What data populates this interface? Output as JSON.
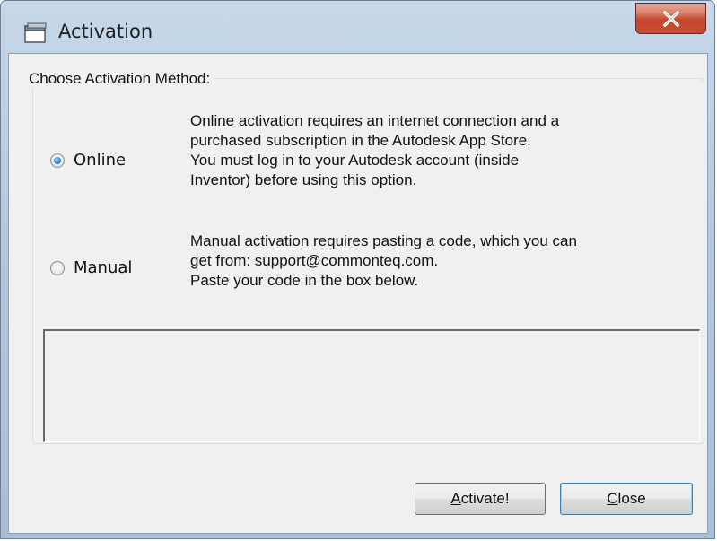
{
  "window": {
    "title": "Activation",
    "close_glyph": "X"
  },
  "group": {
    "legend": "Choose Activation Method:"
  },
  "options": [
    {
      "label": "Online",
      "checked": true,
      "description": [
        "Online activation requires an internet connection and a",
        "purchased subscription in the Autodesk App Store.",
        "You must log in to your Autodesk account (inside",
        "Inventor) before using this option."
      ]
    },
    {
      "label": "Manual",
      "checked": false,
      "description": [
        "Manual activation requires pasting a code, which you can",
        "get from: support@commonteq.com.",
        "Paste your code in the box below."
      ]
    }
  ],
  "code_input": {
    "value": ""
  },
  "buttons": {
    "activate": {
      "mnemonic": "A",
      "rest": "ctivate!"
    },
    "close": {
      "mnemonic": "C",
      "rest": "lose"
    }
  },
  "icons": {
    "app": "window-app-icon",
    "close": "close-x-icon"
  }
}
